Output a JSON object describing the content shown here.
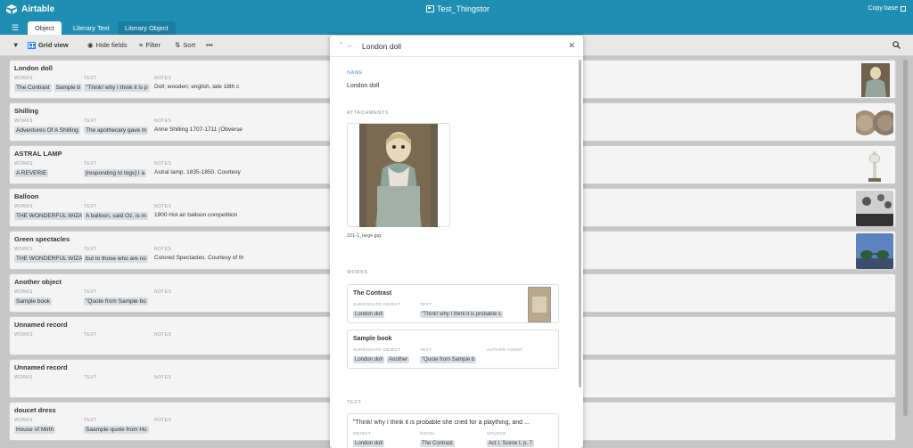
{
  "app": {
    "name": "Airtable",
    "base_title": "Test_Thingstor",
    "copy_base": "Copy base"
  },
  "tabs": [
    {
      "label": "Object",
      "active": true
    },
    {
      "label": "Literary Text",
      "active": false
    },
    {
      "label": "Literary Object",
      "active": false
    }
  ],
  "toolbar": {
    "view": "Grid view",
    "hide_fields": "Hide fields",
    "filter": "Filter",
    "sort": "Sort",
    "more": "•••"
  },
  "field_labels": {
    "works": "WORKS",
    "text": "TEXT",
    "notes": "NOTES"
  },
  "records": [
    {
      "title": "London doll",
      "works": [
        "The Contrast",
        "Sample b"
      ],
      "text": "\"Think! why I think it is p",
      "notes": "Doll; wooden; english, late 18th c",
      "thumb": "doll"
    },
    {
      "title": "Shilling",
      "works": [
        "Adventures Of A Shilling"
      ],
      "text": "The apothecary gave m",
      "notes": "Anne Shilling 1707-1711 (Obverse",
      "thumb": "coin"
    },
    {
      "title": "ASTRAL LAMP",
      "works": [
        "A REVERIE"
      ],
      "text": "[responding to togs] I a",
      "notes": "Astral lamp, 1835-1850. Courtesy",
      "thumb": "lamp"
    },
    {
      "title": "Balloon",
      "works": [
        "THE WONDERFUL WIZA"
      ],
      "text": "A balloon, said Oz, is m",
      "notes": "1900 Hot air balloon competition",
      "thumb": "balloon"
    },
    {
      "title": "Green spectacles",
      "works": [
        "THE WONDERFUL WIZA"
      ],
      "text": "but to those who are no",
      "notes": "Colored Spectacles. Courtesy of th",
      "thumb": "glasses"
    },
    {
      "title": "Another object",
      "works": [
        "Sample book"
      ],
      "text": "\"Quote from Sample bo",
      "notes": "",
      "thumb": ""
    },
    {
      "title": "Unnamed record",
      "works": [],
      "text": "",
      "notes": "",
      "thumb": ""
    },
    {
      "title": "Unnamed record",
      "works": [],
      "text": "",
      "notes": "",
      "thumb": ""
    },
    {
      "title": "doucet dress",
      "works": [
        "House of Mirth"
      ],
      "text": "Saample quote from Ho",
      "notes": "",
      "thumb": ""
    }
  ],
  "modal": {
    "title": "London doll",
    "name_label": "NAME",
    "name_value": "London doll",
    "attachments_label": "ATTACHMENTS",
    "attachment_file": "221-1_large.jpg",
    "works_label": "WORKS",
    "works": [
      {
        "title": "The Contrast",
        "l1": "SURROGATE OBJECT",
        "l2": "TEXT",
        "l3": "",
        "v1": "London doll",
        "v1b": "",
        "v2": "\"Think! why I think it is probable s"
      },
      {
        "title": "Sample book",
        "l1": "SURROGATE OBJECT",
        "l2": "TEXT",
        "l3": "AUTHOR AGENT",
        "v1": "London doll",
        "v1b": "Another",
        "v2": "\"Quote from Sample b"
      }
    ],
    "text_label": "TEXT",
    "text_card": {
      "title": "\"Think! why I think it is probable she cried for a plaything, and ...",
      "l1": "OBJECT",
      "l2": "NOVEL",
      "l3": "SOURCE",
      "v1": "London doll",
      "v2": "The Contrast",
      "v3": "Act I, Scene I, p. 7"
    }
  },
  "colors": {
    "brand": "#1e8fb3",
    "chip": "#d7dde4"
  }
}
